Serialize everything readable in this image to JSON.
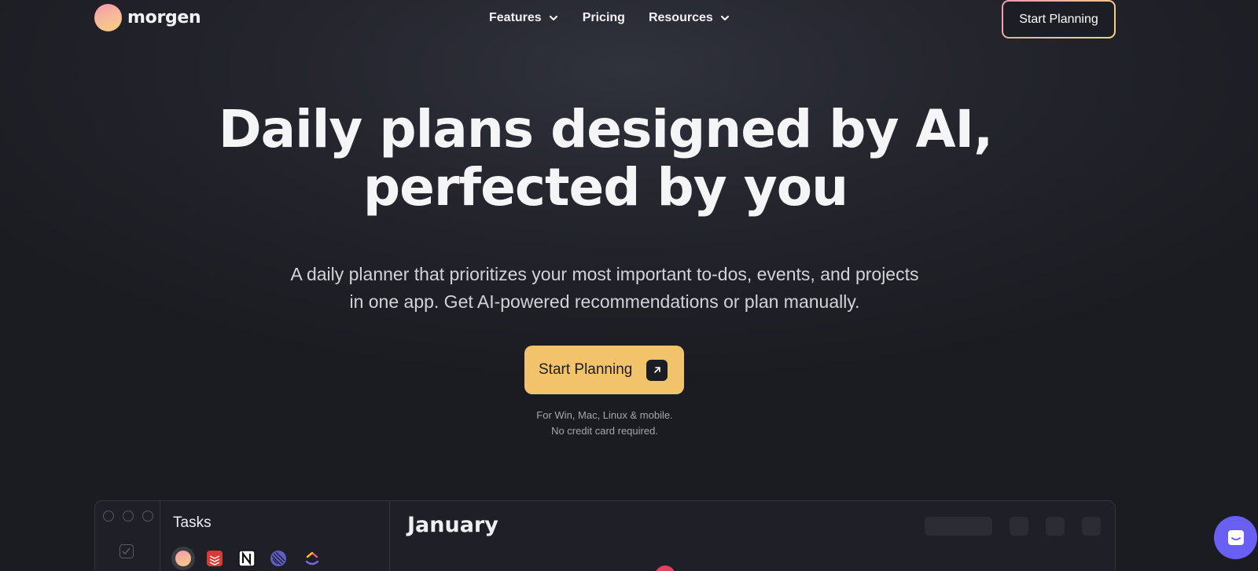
{
  "brand": {
    "name": "morgen"
  },
  "nav": {
    "items": [
      {
        "label": "Features",
        "has_dropdown": true
      },
      {
        "label": "Pricing",
        "has_dropdown": false
      },
      {
        "label": "Resources",
        "has_dropdown": true
      }
    ],
    "cta_label": "Start Planning"
  },
  "hero": {
    "title_line1": "Daily plans designed by AI,",
    "title_line2": "perfected by you",
    "subtitle_line1": "A daily planner that prioritizes your most important to-dos, events, and projects",
    "subtitle_line2": "in one app. Get AI-powered recommendations or plan manually.",
    "cta_label": "Start Planning",
    "note_line1": "For Win, Mac, Linux & mobile.",
    "note_line2": "No credit card required."
  },
  "preview": {
    "tasks_title": "Tasks",
    "calendar_title": "January",
    "integrations": [
      "morgen-icon",
      "todoist-icon",
      "notion-icon",
      "linear-icon",
      "clickup-icon"
    ]
  },
  "colors": {
    "accent": "#F3C36B",
    "chat": "#6A5FF3",
    "background": "#24252D"
  }
}
